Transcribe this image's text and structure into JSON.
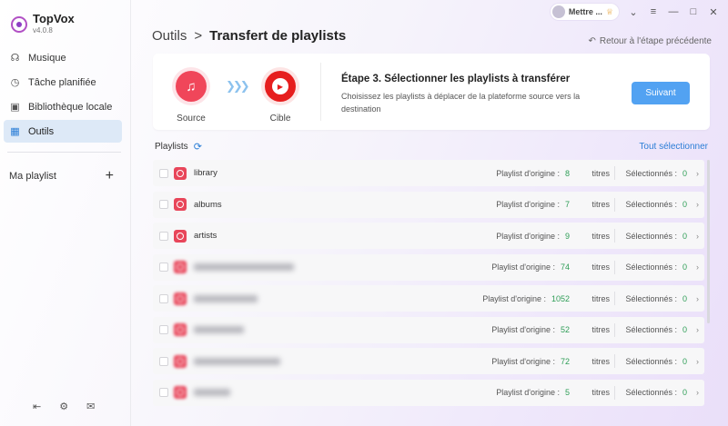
{
  "app": {
    "name": "TopVox",
    "version": "v4.0.8"
  },
  "sidebar": {
    "items": [
      {
        "label": "Musique",
        "icon": "headphones-icon",
        "active": false
      },
      {
        "label": "Tâche planifiée",
        "icon": "clock-icon",
        "active": false
      },
      {
        "label": "Bibliothèque locale",
        "icon": "folder-icon",
        "active": false
      },
      {
        "label": "Outils",
        "icon": "grid-icon",
        "active": true
      }
    ],
    "my_playlist": "Ma playlist"
  },
  "topbar": {
    "user": "Mettre ..."
  },
  "header": {
    "breadcrumb_root": "Outils",
    "breadcrumb_sep": ">",
    "breadcrumb_current": "Transfert de playlists",
    "back_link": "Retour à l'étape précédente"
  },
  "step": {
    "source_label": "Source",
    "target_label": "Cible",
    "title": "Étape 3. Sélectionner les playlists à transférer",
    "description": "Choisissez les playlists à déplacer de la plateforme source vers la destination",
    "next_button": "Suivant"
  },
  "playlists_header": {
    "label": "Playlists",
    "select_all": "Tout sélectionner"
  },
  "row_labels": {
    "origin": "Playlist d'origine :",
    "tracks": "titres",
    "selected": "Sélectionnés :"
  },
  "playlists": [
    {
      "name": "library",
      "origin": "8",
      "selected": "0",
      "blurred": false
    },
    {
      "name": "albums",
      "origin": "7",
      "selected": "0",
      "blurred": false
    },
    {
      "name": "artists",
      "origin": "9",
      "selected": "0",
      "blurred": false
    },
    {
      "name": "",
      "origin": "74",
      "selected": "0",
      "blurred": true
    },
    {
      "name": "",
      "origin": "1052",
      "selected": "0",
      "blurred": true
    },
    {
      "name": "",
      "origin": "52",
      "selected": "0",
      "blurred": true
    },
    {
      "name": "",
      "origin": "72",
      "selected": "0",
      "blurred": true
    },
    {
      "name": "",
      "origin": "5",
      "selected": "0",
      "blurred": true
    }
  ],
  "colors": {
    "accent": "#2a7dd6",
    "button": "#52a2f2",
    "count_green": "#2f9e57",
    "source_red": "#f0465a",
    "target_red": "#e61e1e"
  }
}
